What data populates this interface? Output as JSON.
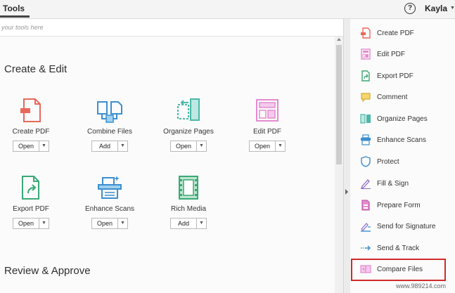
{
  "header": {
    "tab_label": "Tools",
    "help_glyph": "?",
    "user_name": "Kayla"
  },
  "search": {
    "placeholder": "your tools here"
  },
  "sections": {
    "create_edit": "Create & Edit",
    "review_approve": "Review & Approve"
  },
  "tools": [
    {
      "label": "Create PDF",
      "button": "Open",
      "icon": "create-pdf-icon"
    },
    {
      "label": "Combine Files",
      "button": "Add",
      "icon": "combine-files-icon"
    },
    {
      "label": "Organize Pages",
      "button": "Open",
      "icon": "organize-pages-icon"
    },
    {
      "label": "Edit PDF",
      "button": "Open",
      "icon": "edit-pdf-icon"
    },
    {
      "label": "Export PDF",
      "button": "Open",
      "icon": "export-pdf-icon"
    },
    {
      "label": "Enhance Scans",
      "button": "Open",
      "icon": "enhance-scans-icon"
    },
    {
      "label": "Rich Media",
      "button": "Add",
      "icon": "rich-media-icon"
    }
  ],
  "right_panel": [
    {
      "label": "Create PDF",
      "icon": "create-pdf-icon"
    },
    {
      "label": "Edit PDF",
      "icon": "edit-pdf-icon"
    },
    {
      "label": "Export PDF",
      "icon": "export-pdf-icon"
    },
    {
      "label": "Comment",
      "icon": "comment-icon"
    },
    {
      "label": "Organize Pages",
      "icon": "organize-pages-icon"
    },
    {
      "label": "Enhance Scans",
      "icon": "enhance-scans-icon"
    },
    {
      "label": "Protect",
      "icon": "shield-icon"
    },
    {
      "label": "Fill & Sign",
      "icon": "pen-icon"
    },
    {
      "label": "Prepare Form",
      "icon": "form-icon"
    },
    {
      "label": "Send for Signature",
      "icon": "send-signature-icon"
    },
    {
      "label": "Send & Track",
      "icon": "send-track-icon"
    },
    {
      "label": "Compare Files",
      "icon": "compare-files-icon"
    }
  ],
  "watermark": "www.989214.com",
  "colors": {
    "highlight": "#d12a2a",
    "pdf_red": "#e8685b",
    "blue": "#3b8fd0",
    "teal": "#4bb7a8",
    "pink": "#e48bd0",
    "green": "#3aa876",
    "purple": "#8c6cc7"
  }
}
